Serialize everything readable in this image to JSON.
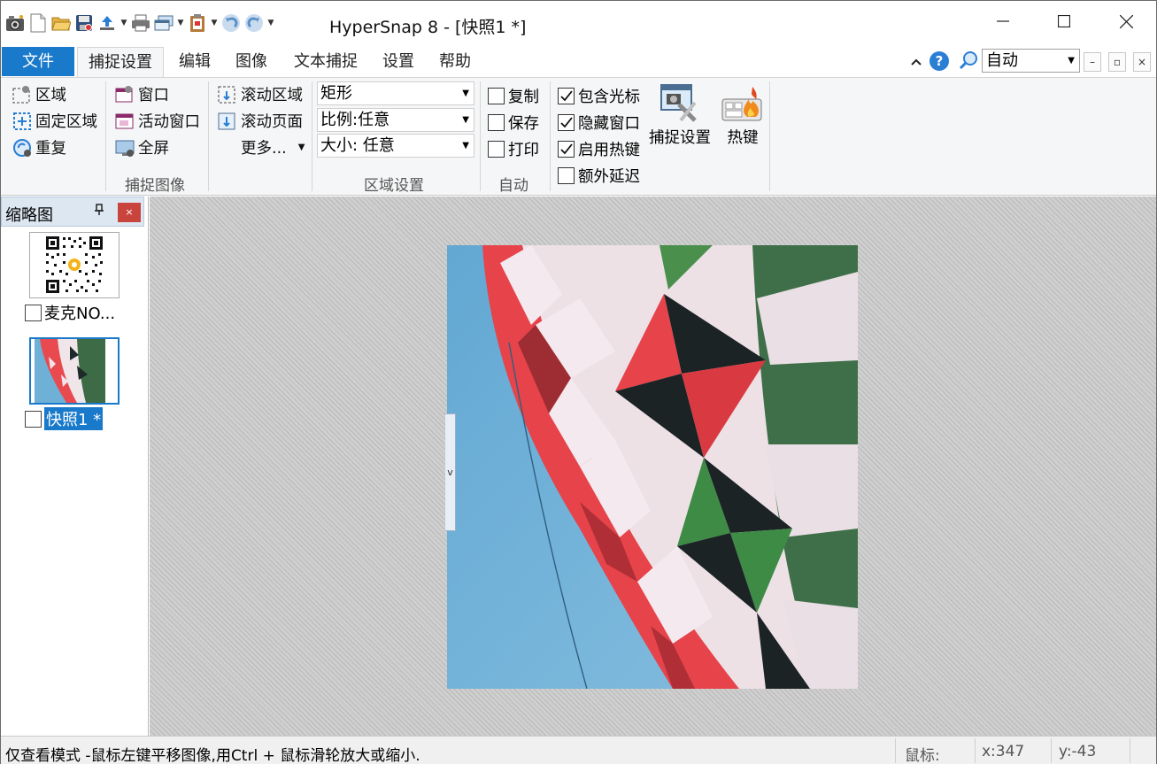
{
  "window": {
    "title": "HyperSnap 8 - [快照1 *]"
  },
  "quick_access": {
    "icons": [
      "camera-icon",
      "new-file-icon",
      "open-folder-icon",
      "save-icon",
      "upload-icon",
      "print-icon",
      "multi-window-icon",
      "clipboard-icon",
      "undo-icon",
      "redo-icon",
      "customize-icon"
    ]
  },
  "menu": {
    "file": "文件",
    "tabs": [
      "捕捉设置",
      "编辑",
      "图像",
      "文本捕捉",
      "设置",
      "帮助"
    ],
    "zoom": "自动"
  },
  "ribbon": {
    "capture_image": {
      "label": "捕捉图像",
      "col1": [
        "区域",
        "固定区域",
        "重复"
      ],
      "col2": [
        "窗口",
        "活动窗口",
        "全屏"
      ],
      "col3": [
        "滚动区域",
        "滚动页面",
        "更多..."
      ]
    },
    "region_settings": {
      "label": "区域设置",
      "shape": "矩形",
      "ratio": "比例:任意",
      "size": "大小: 任意"
    },
    "auto": {
      "label": "自动",
      "items": [
        {
          "text": "复制",
          "checked": false
        },
        {
          "text": "保存",
          "checked": false
        },
        {
          "text": "打印",
          "checked": false
        }
      ]
    },
    "options": [
      {
        "text": "包含光标",
        "checked": true
      },
      {
        "text": "隐藏窗口",
        "checked": true
      },
      {
        "text": "启用热键",
        "checked": true
      },
      {
        "text": "额外延迟",
        "checked": false
      }
    ],
    "capture_settings": "捕捉设置",
    "hotkeys": "热键"
  },
  "thumbnails": {
    "title": "缩略图",
    "items": [
      {
        "caption": "麦克NO...",
        "selected": false
      },
      {
        "caption": "快照1 *",
        "selected": true
      }
    ]
  },
  "status": {
    "message": "仅查看模式 -鼠标左键平移图像,用Ctrl + 鼠标滑轮放大或缩小.",
    "mouse_label": "鼠标:",
    "x": "x:347",
    "y": "y:-43"
  },
  "colors": {
    "accent": "#1979ca",
    "close_red": "#c9443c"
  }
}
